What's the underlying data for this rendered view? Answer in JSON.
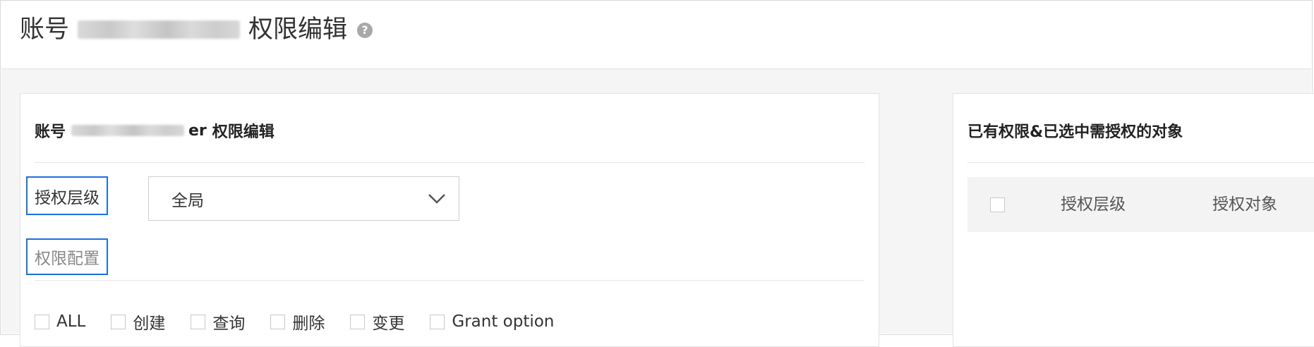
{
  "header": {
    "title_prefix": "账号",
    "title_suffix": "权限编辑",
    "help_symbol": "?"
  },
  "left_panel": {
    "title_prefix": "账号",
    "title_visible_tail": "er",
    "title_suffix": "权限编辑",
    "auth_level_label": "授权层级",
    "auth_level_value": "全局",
    "perm_config_label": "权限配置",
    "permissions": [
      "ALL",
      "创建",
      "查询",
      "删除",
      "变更",
      "Grant option"
    ]
  },
  "right_panel": {
    "title": "已有权限&已选中需授权的对象",
    "columns": [
      "授权层级",
      "授权对象"
    ]
  },
  "colors": {
    "highlight_border": "#1f6fde",
    "background": "#f5f5f5",
    "table_header": "#f3f3f3"
  },
  "icons": {
    "help": "help-icon",
    "dropdown": "chevron-down-icon"
  }
}
